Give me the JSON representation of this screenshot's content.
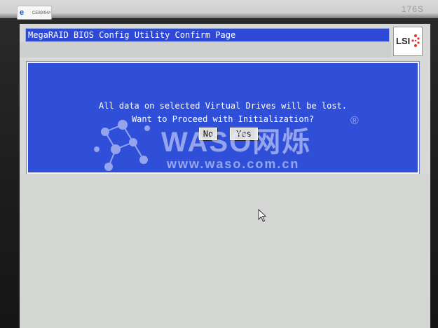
{
  "monitor": {
    "sticker_text": "CE89/94/CE/GS",
    "model_label": "176S"
  },
  "screen": {
    "title": "MegaRAID BIOS Config Utility  Confirm Page",
    "logo_text": "LSI"
  },
  "dialog": {
    "line1": "All data on selected Virtual Drives will be lost.",
    "line2": "Want to Proceed with Initialization?",
    "no_label": "No",
    "yes_label": "Yes"
  },
  "watermark": {
    "name": "WASO网烁",
    "url": "www.waso.com.cn",
    "reg_mark": "®"
  },
  "colors": {
    "title_bar": "#2e49d6",
    "dialog": "#2f4fd8",
    "screen_bg": "#d7d9d7"
  }
}
